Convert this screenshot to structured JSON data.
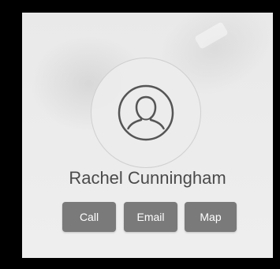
{
  "contact": {
    "name": "Rachel Cunningham",
    "avatar_icon": "person-silhouette-icon"
  },
  "actions": {
    "call_label": "Call",
    "email_label": "Email",
    "map_label": "Map"
  },
  "colors": {
    "background": "#000000",
    "card": "#ebebeb",
    "button": "#7a7a7a",
    "button_text": "#ffffff",
    "name_text": "#4a4a4a",
    "icon_stroke": "#555555"
  }
}
